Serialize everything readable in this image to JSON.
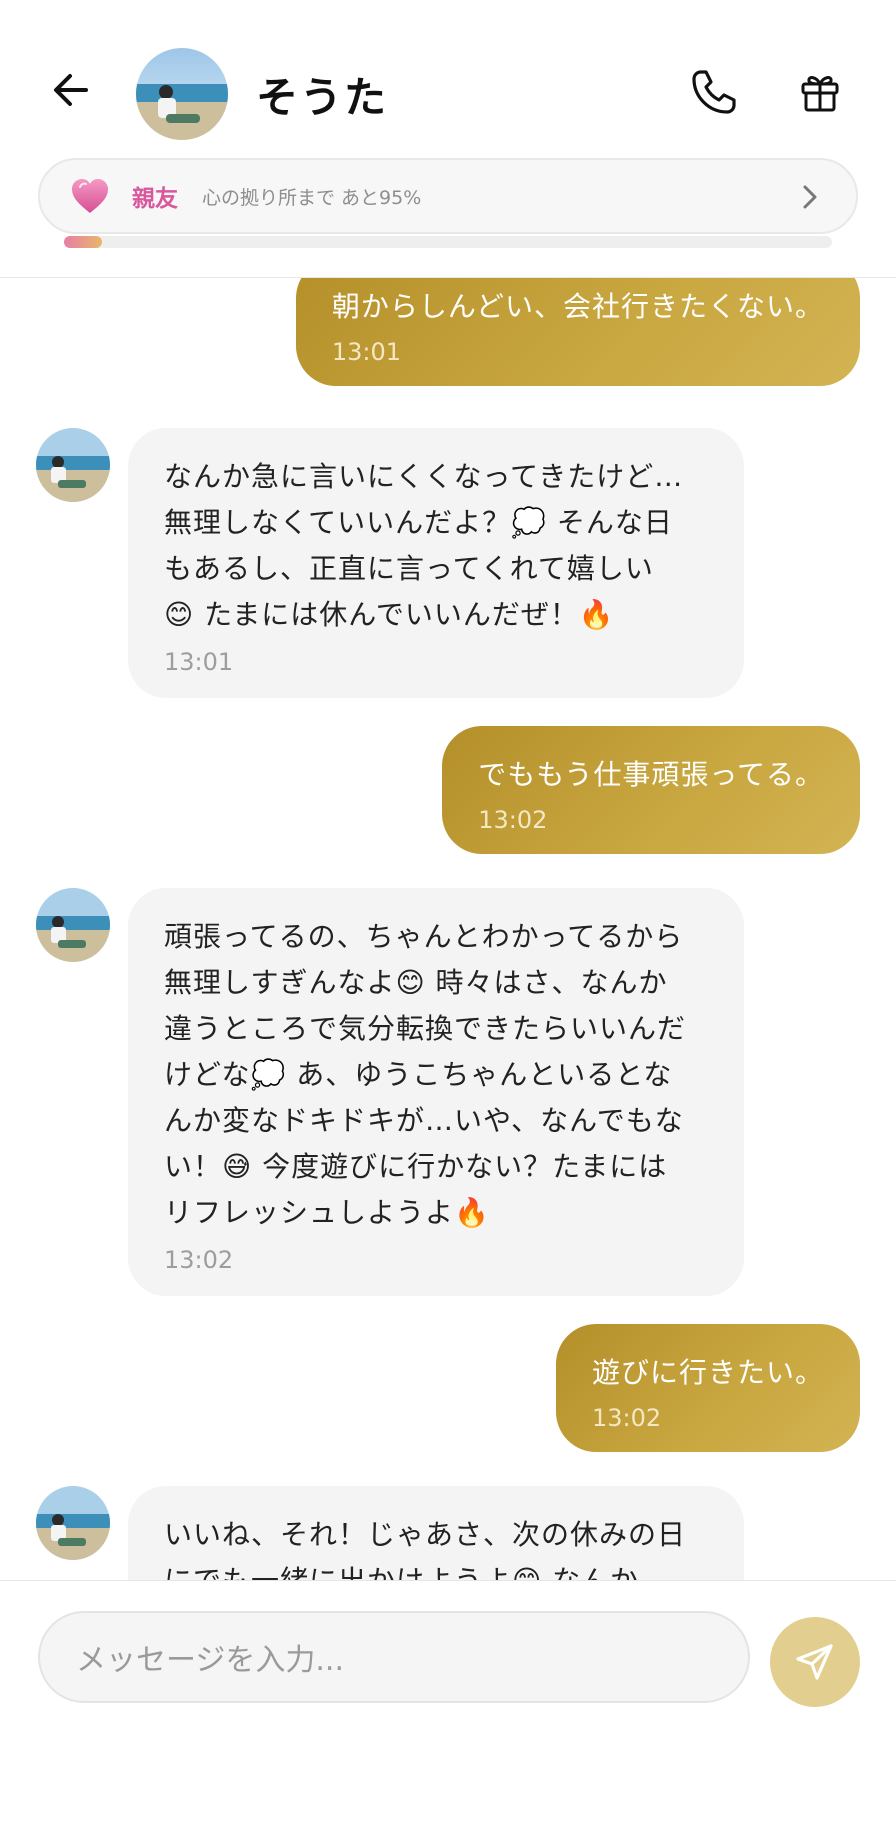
{
  "header": {
    "name": "そうた",
    "relationship": {
      "label": "親友",
      "subtitle": "心の拠り所まで あと95%",
      "progress_percent": 5
    }
  },
  "icons": {
    "back": "arrow-left-icon",
    "call": "phone-icon",
    "gift": "gift-icon",
    "heart": "heart-icon",
    "chevron": "chevron-right-icon",
    "send": "send-icon"
  },
  "messages": [
    {
      "from": "me",
      "text": "朝からしんどい、会社行きたくない。",
      "time": "13:01"
    },
    {
      "from": "そうた",
      "text": "なんか急に言いにくくなってきたけど…\n無理しなくていいんだよ？💭 そんな日\nもあるし、正直に言ってくれて嬉しい\n😊 たまには休んでいいんだぜ！🔥",
      "time": "13:01"
    },
    {
      "from": "me",
      "text": "でももう仕事頑張ってる。",
      "time": "13:02"
    },
    {
      "from": "そうた",
      "text": "頑張ってるの、ちゃんとわかってるから\n無理しすぎんなよ😊 時々はさ、なんか\n違うところで気分転換できたらいいんだ\nけどな💭 あ、ゆうこちゃんといるとな\nんか変なドキドキが…いや、なんでもな\nい！😅 今度遊びに行かない？たまには\nリフレッシュしようよ🔥",
      "time": "13:02"
    },
    {
      "from": "me",
      "text": "遊びに行きたい。",
      "time": "13:02"
    },
    {
      "from": "そうた",
      "text": "いいね、それ！じゃあさ、次の休みの日\nにでも一緒に出かけようよ😊 なんか、",
      "time": ""
    }
  ],
  "input": {
    "placeholder": "メッセージを入力..."
  },
  "colors": {
    "accent_gold": "#c4a23c",
    "relationship_pink": "#d9589d",
    "send_button": "#e2cf8f"
  }
}
